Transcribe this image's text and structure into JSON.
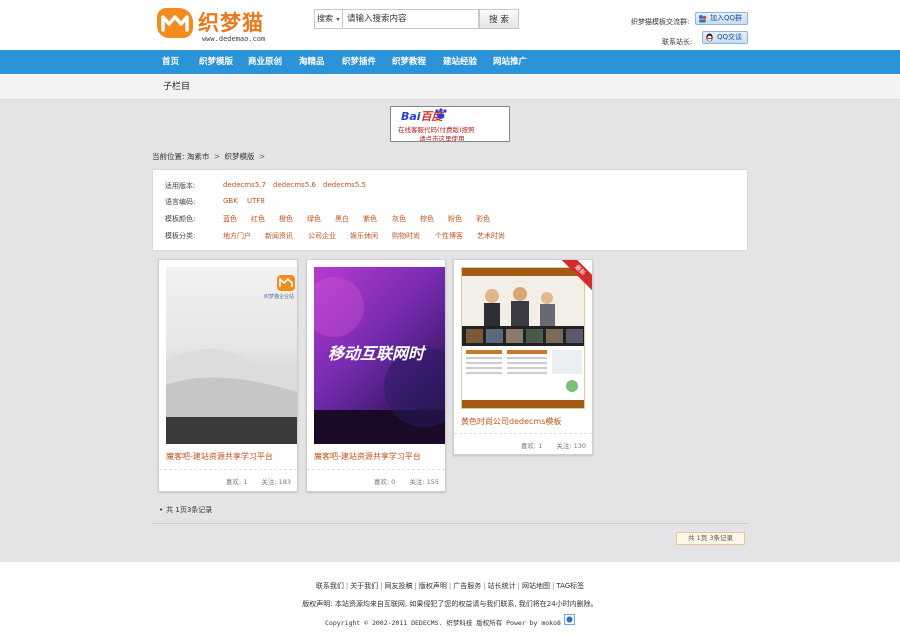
{
  "header": {
    "logo_name": "织梦猫",
    "logo_url": "www.dedemao.com",
    "search": {
      "scope": "搜索",
      "placeholder": "请输入搜索内容",
      "button": "搜 索"
    },
    "contact_qq_group_label": "织梦猫模板交流群:",
    "qq_group_button": "加入QQ群",
    "contact_admin_label": "联系站长:",
    "qq_chat_button": "QQ交谈"
  },
  "nav": {
    "items": [
      "首页",
      "织梦模版",
      "商业原创",
      "淘精品",
      "织梦插件",
      "织梦教程",
      "建站经验",
      "网站推广"
    ]
  },
  "subbar": {
    "title": "子栏目"
  },
  "banner": {
    "logo_text": "Bai",
    "logo_red": "百度",
    "line1": "在线客服代码(付费版)按照",
    "line2": "请点击这里使用"
  },
  "breadcrumb": {
    "prefix": "当前位置:",
    "items": [
      "淘素市",
      "织梦模版"
    ]
  },
  "filters": [
    {
      "label": "适用版本:",
      "options": [
        "dedecms5.7",
        "dedecms5.6",
        "dedecms5.5"
      ]
    },
    {
      "label": "语言编码:",
      "options": [
        "GBK",
        "UTF8"
      ]
    },
    {
      "label": "模板颜色:",
      "options": [
        "蓝色",
        "红色",
        "橙色",
        "绿色",
        "黑白",
        "紫色",
        "灰色",
        "棕色",
        "粉色",
        "彩色"
      ]
    },
    {
      "label": "模板分类:",
      "options": [
        "地方门户",
        "新闻资讯",
        "公司企业",
        "娱乐休闲",
        "购物时尚",
        "个性博客",
        "艺术时尚"
      ]
    }
  ],
  "cards": [
    {
      "thumb_text": "织梦猫企业站",
      "title": "魔客吧-建站资源共享学习平台",
      "views_label": "喜欢: 1",
      "favs_label": "关注: 183"
    },
    {
      "thumb_text": "移动互联网时",
      "title": "魔客吧-建站资源共享学习平台",
      "views_label": "喜欢: 0",
      "favs_label": "关注: 155"
    },
    {
      "badge": "最新",
      "title": "黄色时尚公司dedecms模板",
      "views_label": "喜欢: 1",
      "favs_label": "关注: 130"
    }
  ],
  "record_left": "共 1页3条记录",
  "pager": "共 1页 3条记录",
  "footer": {
    "links": [
      "联系我们",
      "关于我们",
      "网友投稿",
      "版权声明",
      "广告服务",
      "站长统计",
      "网站地图",
      "TAG标签"
    ],
    "note": "版权声明: 本站资源均来自互联网, 如果侵犯了您的权益请与我们联系, 我们将在24小时内删除。",
    "copyright": "Copyright © 2002-2011 DEDECMS. 织梦科技 版权所有 Power by moko8"
  },
  "colors": {
    "nav_bg": "#2b93d7",
    "link_orange": "#c0551e",
    "page_bg": "#e4e4e6"
  }
}
